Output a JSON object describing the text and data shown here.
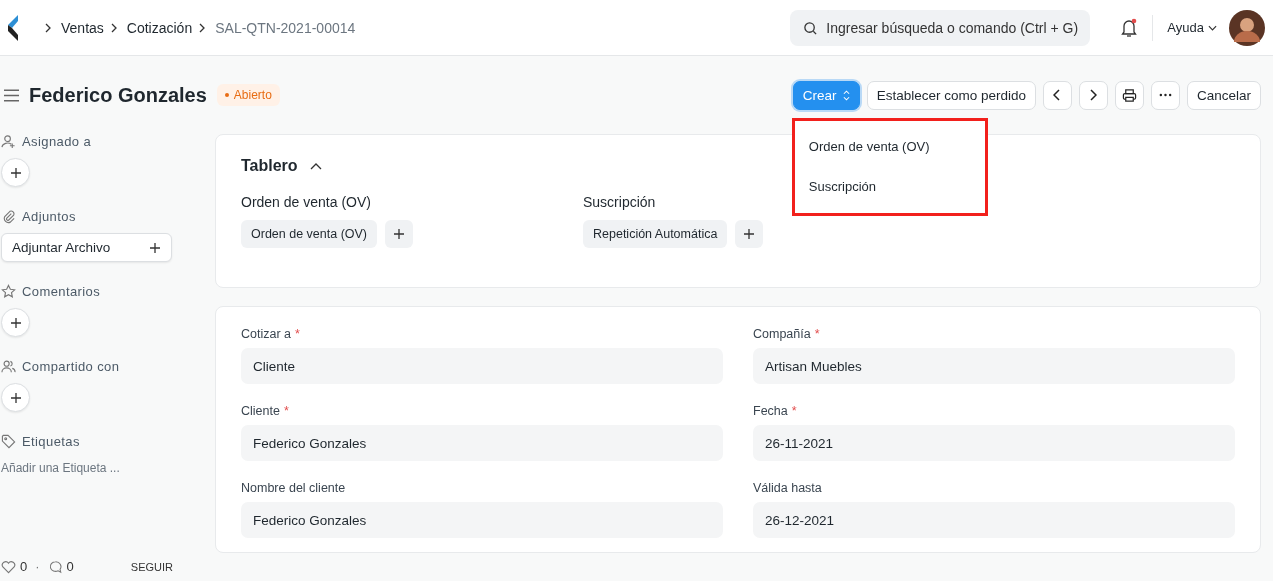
{
  "breadcrumbs": [
    {
      "label": "Ventas",
      "current": false
    },
    {
      "label": "Cotización",
      "current": false
    },
    {
      "label": "SAL-QTN-2021-00014",
      "current": true
    }
  ],
  "search": {
    "placeholder": "Ingresar búsqueda o comando (Ctrl + G)"
  },
  "notifications": {
    "unread": true
  },
  "help": "Ayuda",
  "title": "Federico Gonzales",
  "status": "Abierto",
  "actions": {
    "primary": "Crear",
    "buttons": [
      "Establecer como perdido"
    ],
    "cancel": "Cancelar"
  },
  "dropdown": {
    "items": [
      "Orden de venta (OV)",
      "Suscripción"
    ]
  },
  "sidebar": {
    "sections": [
      {
        "kind": "assign",
        "label": "Asignado a"
      },
      {
        "kind": "attach",
        "label": "Adjuntos",
        "button": "Adjuntar Archivo"
      },
      {
        "kind": "comment",
        "label": "Comentarios"
      },
      {
        "kind": "share",
        "label": "Compartido con"
      },
      {
        "kind": "tags",
        "label": "Etiquetas",
        "placeholder": "Añadir una Etiqueta ..."
      }
    ],
    "likes": "0",
    "separator": "·",
    "comments": "0",
    "follow": "SEGUIR"
  },
  "dashboard": {
    "title": "Tablero",
    "expanded": true,
    "groups": [
      {
        "heading": "Orden de venta (OV)",
        "link": "Orden de venta (OV)"
      },
      {
        "heading": "Suscripción",
        "link": "Repetición Automática"
      }
    ]
  },
  "fields": [
    {
      "label": "Cotizar a",
      "required_mark": "*",
      "value": "Cliente"
    },
    {
      "label": "Compañía",
      "required_mark": "*",
      "value": "Artisan Muebles"
    },
    {
      "label": "Cliente",
      "required_mark": "*",
      "value": "Federico Gonzales"
    },
    {
      "label": "Fecha",
      "required_mark": "*",
      "value": "26-11-2021"
    },
    {
      "label": "Nombre del cliente",
      "value": "Federico Gonzales"
    },
    {
      "label": "Válida hasta",
      "value": "26-12-2021"
    }
  ]
}
